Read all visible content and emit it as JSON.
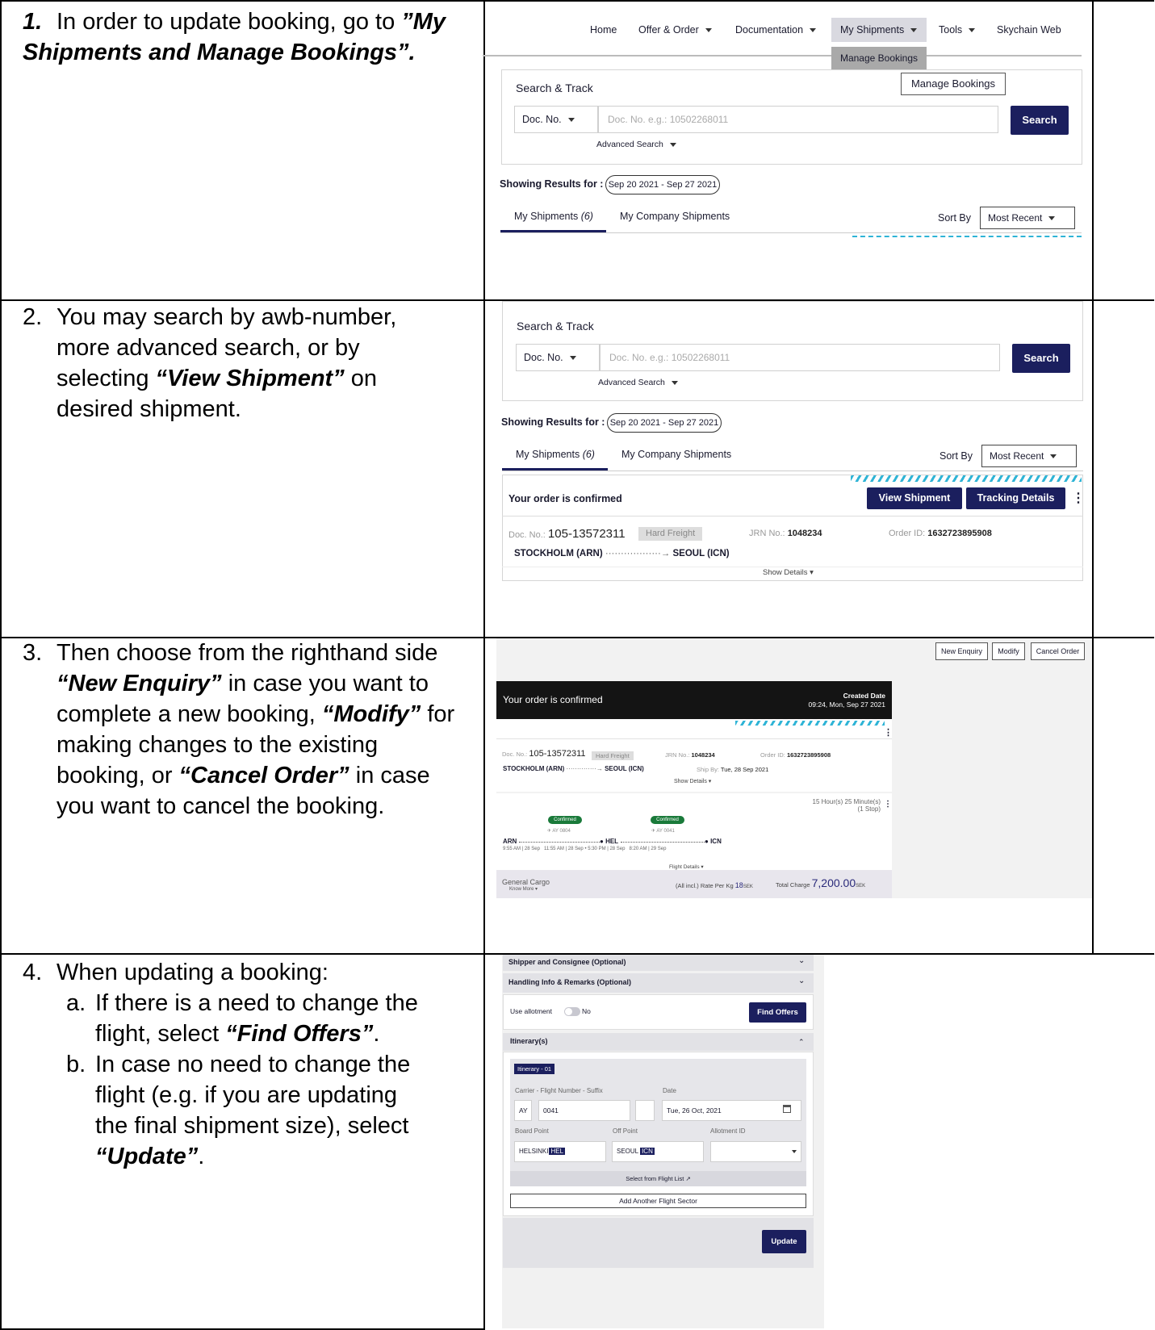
{
  "steps": {
    "s1": {
      "num": "1.",
      "pre": "In order to update booking, go to ",
      "em": "”My Shipments and Manage Bookings”."
    },
    "s2": {
      "num": "2.",
      "line1": "You may search by awb-number,",
      "line2": "more advanced search, or by",
      "line3_pre": "selecting ",
      "line3_em": "“View Shipment”",
      "line3_post": " on",
      "line4": "desired shipment."
    },
    "s3": {
      "num": "3.",
      "line1": "Then choose from the righthand side",
      "line2_em": "“New Enquiry”",
      "line2_post": " in case you want to",
      "line3_pre": "complete a new booking, ",
      "line3_em": "“Modify”",
      "line3_post": " for",
      "line4": "making changes to the existing",
      "line5_pre": "booking, or ",
      "line5_em": "“Cancel Order”",
      "line5_post": " in case",
      "line6": "you want to cancel the booking."
    },
    "s4": {
      "num": "4.",
      "title": "When updating a booking:",
      "a_letter": "a.",
      "a1": "If there is a need to change the",
      "a2_pre": "flight, select ",
      "a2_em": "“Find Offers”",
      "a2_post": ".",
      "b_letter": "b.",
      "b1": "In case no need to change the",
      "b2": "flight (e.g. if you are updating",
      "b3": "the final shipment size), select",
      "b4_em": "“Update”",
      "b4_post": "."
    }
  },
  "nav": {
    "items": [
      "Home",
      "Offer & Order",
      "Documentation",
      "My Shipments",
      "Tools",
      "Skychain Web"
    ],
    "dropdown": "Manage Bookings",
    "tooltip": "Manage Bookings"
  },
  "search": {
    "title": "Search & Track",
    "type": "Doc. No.",
    "placeholder": "Doc. No. e.g.: 10502268011",
    "button": "Search",
    "advanced": "Advanced Search"
  },
  "results": {
    "label": "Showing Results for :",
    "range": "Sep 20 2021 - Sep 27 2021",
    "tab1": "My Shipments",
    "tab1_count": "(6)",
    "tab2": "My Company Shipments",
    "sort_label": "Sort By",
    "sort_value": "Most Recent"
  },
  "shipment": {
    "status": "Your order is confirmed",
    "view": "View Shipment",
    "tracking": "Tracking Details",
    "doc_label": "Doc. No.:",
    "doc": "105-13572311",
    "tag": "Hard Freight",
    "jrn_label": "JRN No.:",
    "jrn": "1048234",
    "order_label": "Order ID:",
    "order": "1632723895908",
    "from": "STOCKHOLM (ARN)",
    "to": "SEOUL (ICN)",
    "show": "Show Details"
  },
  "order": {
    "btn_new": "New Enquiry",
    "btn_modify": "Modify",
    "btn_cancel": "Cancel Order",
    "status": "Your order is confirmed",
    "created_label": "Created Date",
    "created": "09:24, Mon, Sep 27 2021",
    "doc_label": "Doc. No.:",
    "doc": "105-13572311",
    "tag": "Hard Freight",
    "jrn_label": "JRN No.:",
    "jrn": "1048234",
    "order_label": "Order ID:",
    "order": "1632723895908",
    "from": "STOCKHOLM (ARN)",
    "to": "SEOUL (ICN)",
    "ship_label": "Ship By:",
    "ship": "Tue, 28 Sep 2021",
    "show": "Show Details",
    "duration": "15 Hour(s) 25 Minute(s)",
    "stops": "(1 Stop)",
    "badge": "Confirmed",
    "f1": "AY 0804",
    "f2": "AY 0041",
    "a1": "ARN",
    "a2": "HEL",
    "a3": "ICN",
    "t1": "9:55 AM | 28 Sep",
    "t2": "11:55 AM | 28 Sep",
    "t3": "5:30 PM | 28 Sep",
    "t4": "8:20 AM | 29 Sep",
    "flight_details": "Flight Details",
    "cargo": "General Cargo",
    "know": "Know More",
    "rate_label": "(All incl.) Rate Per Kg",
    "rate": "18",
    "rate_cur": "SEK",
    "total_label": "Total Charge",
    "total": "7,200.00",
    "total_cur": "SEK"
  },
  "form": {
    "shipper": "Shipper and Consignee (Optional)",
    "handling": "Handling Info & Remarks (Optional)",
    "allot_label": "Use allotment",
    "allot_value": "No",
    "find": "Find Offers",
    "itin": "Itinerary(s)",
    "itin_tag": "Itinerary - 01",
    "carrier_label": "Carrier - Flight Number - Suffix",
    "date_label": "Date",
    "carrier": "AY",
    "flight": "0041",
    "date": "Tue, 26 Oct, 2021",
    "board_label": "Board Point",
    "off_label": "Off Point",
    "allot_id_label": "Allotment ID",
    "board": "HELSINKI",
    "board_code": "HEL",
    "off": "SEOUL",
    "off_code": "ICN",
    "select_list": "Select from Flight List",
    "add_sector": "Add Another Flight Sector",
    "update": "Update"
  }
}
